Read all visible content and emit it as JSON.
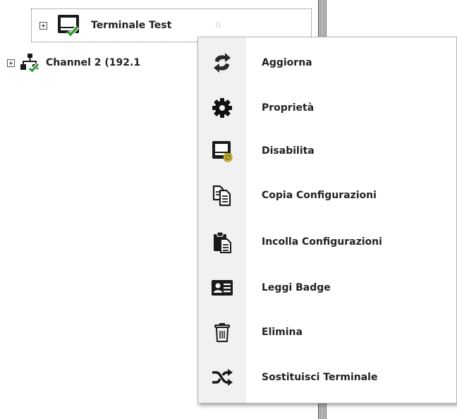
{
  "tree": {
    "nodes": [
      {
        "label": "Terminale Test",
        "count": "0",
        "icon": "terminal-check-icon"
      },
      {
        "label": "Channel 2 (192.1",
        "icon": "network-check-icon"
      }
    ]
  },
  "context_menu": {
    "items": [
      {
        "label": "Aggiorna",
        "icon": "refresh-icon"
      },
      {
        "label": "Proprietà",
        "icon": "gear-icon"
      },
      {
        "label": "Disabilita",
        "icon": "terminal-disable-icon"
      },
      {
        "label": "Copia Configurazioni",
        "icon": "copy-icon"
      },
      {
        "label": "Incolla Configurazioni",
        "icon": "paste-icon"
      },
      {
        "label": "Leggi Badge",
        "icon": "badge-icon"
      },
      {
        "label": "Elimina",
        "icon": "trash-icon"
      },
      {
        "label": "Sostituisci Terminale",
        "icon": "shuffle-icon"
      }
    ]
  },
  "colors": {
    "check_green": "#2e9a2e",
    "icon_dark": "#1a1a1a",
    "disable_yellow": "#f2d21a"
  }
}
